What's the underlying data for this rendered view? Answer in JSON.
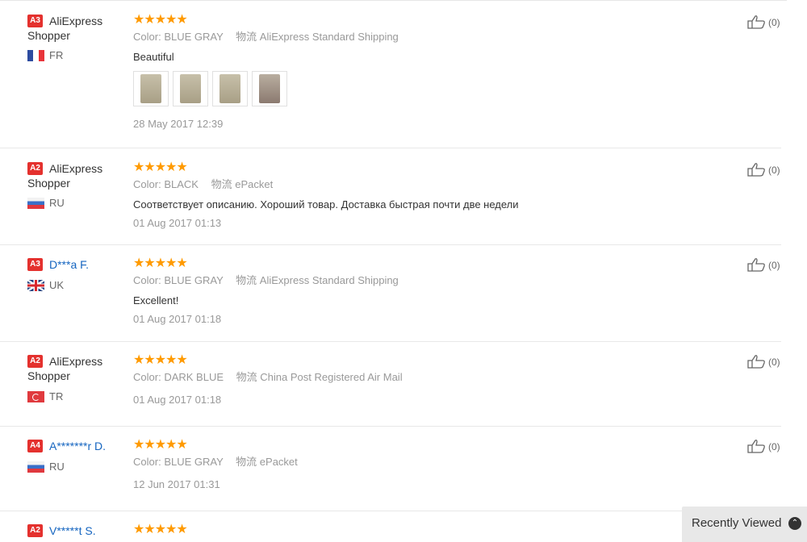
{
  "colors": {
    "star": "#ff9a00",
    "level_badge": "#e4312e",
    "masked_name": "#1565c0"
  },
  "reviews": [
    {
      "level": "A3",
      "name": "AliExpress Shopper",
      "country": "FR",
      "flag": "france-flag-icon",
      "stars": "★★★★★",
      "color_label": "Color:",
      "color_value": "BLUE GRAY",
      "ship_label": "物流",
      "ship_value": "AliExpress Standard Shipping",
      "text": "Beautiful",
      "photos": 4,
      "date": "28 May 2017 12:39",
      "likes": "(0)"
    },
    {
      "level": "A2",
      "name": "AliExpress Shopper",
      "country": "RU",
      "flag": "russia-flag-icon",
      "stars": "★★★★★",
      "color_label": "Color:",
      "color_value": "BLACK",
      "ship_label": "物流",
      "ship_value": "ePacket",
      "text": "Соответствует описанию. Хороший товар. Доставка быстрая почти две недели",
      "date": "01 Aug 2017 01:13",
      "likes": "(0)"
    },
    {
      "level": "A3",
      "name": "D***a F.",
      "country": "UK",
      "flag": "uk-flag-icon",
      "stars": "★★★★★",
      "color_label": "Color:",
      "color_value": "BLUE GRAY",
      "ship_label": "物流",
      "ship_value": "AliExpress Standard Shipping",
      "text": "Excellent!",
      "date": "01 Aug 2017 01:18",
      "likes": "(0)"
    },
    {
      "level": "A2",
      "name": "AliExpress Shopper",
      "country": "TR",
      "flag": "turkey-flag-icon",
      "stars": "★★★★★",
      "color_label": "Color:",
      "color_value": "DARK BLUE",
      "ship_label": "物流",
      "ship_value": "China Post Registered Air Mail",
      "date": "01 Aug 2017 01:18",
      "likes": "(0)"
    },
    {
      "level": "A4",
      "name": "A*******r D.",
      "country": "RU",
      "flag": "russia-flag-icon",
      "stars": "★★★★★",
      "color_label": "Color:",
      "color_value": "BLUE GRAY",
      "ship_label": "物流",
      "ship_value": "ePacket",
      "date": "12 Jun 2017 01:31",
      "likes": "(0)"
    },
    {
      "level": "A2",
      "name": "V*****t S.",
      "stars": "★★★★★"
    }
  ],
  "recently_viewed": {
    "label": "Recently Viewed",
    "icon": "chevron-up-circle-icon"
  }
}
